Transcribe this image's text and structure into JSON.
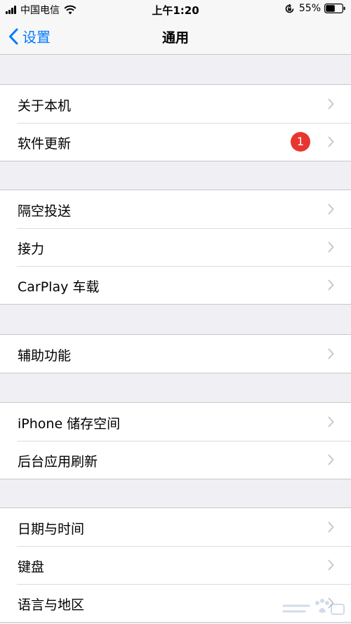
{
  "status_bar": {
    "carrier": "中国电信",
    "time": "上午1:20",
    "battery": "55%"
  },
  "nav": {
    "back_label": "设置",
    "title": "通用"
  },
  "groups": [
    {
      "items": [
        {
          "label": "关于本机"
        },
        {
          "label": "软件更新",
          "badge": "1"
        }
      ]
    },
    {
      "items": [
        {
          "label": "隔空投送"
        },
        {
          "label": "接力"
        },
        {
          "label": "CarPlay 车载"
        }
      ]
    },
    {
      "items": [
        {
          "label": "辅助功能"
        }
      ]
    },
    {
      "items": [
        {
          "label": "iPhone 储存空间"
        },
        {
          "label": "后台应用刷新"
        }
      ]
    },
    {
      "items": [
        {
          "label": "日期与时间"
        },
        {
          "label": "键盘"
        },
        {
          "label": "语言与地区"
        }
      ]
    }
  ],
  "colors": {
    "accent": "#007aff",
    "badge": "#e8362e",
    "background": "#efeff4"
  },
  "icons": {
    "back": "chevron-left-icon",
    "row": "chevron-right-icon"
  }
}
